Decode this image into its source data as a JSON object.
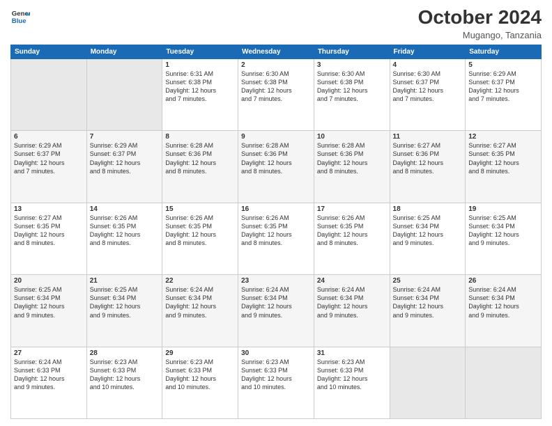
{
  "header": {
    "logo_line1": "General",
    "logo_line2": "Blue",
    "month": "October 2024",
    "location": "Mugango, Tanzania"
  },
  "weekdays": [
    "Sunday",
    "Monday",
    "Tuesday",
    "Wednesday",
    "Thursday",
    "Friday",
    "Saturday"
  ],
  "weeks": [
    [
      {
        "day": "",
        "info": ""
      },
      {
        "day": "",
        "info": ""
      },
      {
        "day": "1",
        "info": "Sunrise: 6:31 AM\nSunset: 6:38 PM\nDaylight: 12 hours\nand 7 minutes."
      },
      {
        "day": "2",
        "info": "Sunrise: 6:30 AM\nSunset: 6:38 PM\nDaylight: 12 hours\nand 7 minutes."
      },
      {
        "day": "3",
        "info": "Sunrise: 6:30 AM\nSunset: 6:38 PM\nDaylight: 12 hours\nand 7 minutes."
      },
      {
        "day": "4",
        "info": "Sunrise: 6:30 AM\nSunset: 6:37 PM\nDaylight: 12 hours\nand 7 minutes."
      },
      {
        "day": "5",
        "info": "Sunrise: 6:29 AM\nSunset: 6:37 PM\nDaylight: 12 hours\nand 7 minutes."
      }
    ],
    [
      {
        "day": "6",
        "info": "Sunrise: 6:29 AM\nSunset: 6:37 PM\nDaylight: 12 hours\nand 7 minutes."
      },
      {
        "day": "7",
        "info": "Sunrise: 6:29 AM\nSunset: 6:37 PM\nDaylight: 12 hours\nand 8 minutes."
      },
      {
        "day": "8",
        "info": "Sunrise: 6:28 AM\nSunset: 6:36 PM\nDaylight: 12 hours\nand 8 minutes."
      },
      {
        "day": "9",
        "info": "Sunrise: 6:28 AM\nSunset: 6:36 PM\nDaylight: 12 hours\nand 8 minutes."
      },
      {
        "day": "10",
        "info": "Sunrise: 6:28 AM\nSunset: 6:36 PM\nDaylight: 12 hours\nand 8 minutes."
      },
      {
        "day": "11",
        "info": "Sunrise: 6:27 AM\nSunset: 6:36 PM\nDaylight: 12 hours\nand 8 minutes."
      },
      {
        "day": "12",
        "info": "Sunrise: 6:27 AM\nSunset: 6:35 PM\nDaylight: 12 hours\nand 8 minutes."
      }
    ],
    [
      {
        "day": "13",
        "info": "Sunrise: 6:27 AM\nSunset: 6:35 PM\nDaylight: 12 hours\nand 8 minutes."
      },
      {
        "day": "14",
        "info": "Sunrise: 6:26 AM\nSunset: 6:35 PM\nDaylight: 12 hours\nand 8 minutes."
      },
      {
        "day": "15",
        "info": "Sunrise: 6:26 AM\nSunset: 6:35 PM\nDaylight: 12 hours\nand 8 minutes."
      },
      {
        "day": "16",
        "info": "Sunrise: 6:26 AM\nSunset: 6:35 PM\nDaylight: 12 hours\nand 8 minutes."
      },
      {
        "day": "17",
        "info": "Sunrise: 6:26 AM\nSunset: 6:35 PM\nDaylight: 12 hours\nand 8 minutes."
      },
      {
        "day": "18",
        "info": "Sunrise: 6:25 AM\nSunset: 6:34 PM\nDaylight: 12 hours\nand 9 minutes."
      },
      {
        "day": "19",
        "info": "Sunrise: 6:25 AM\nSunset: 6:34 PM\nDaylight: 12 hours\nand 9 minutes."
      }
    ],
    [
      {
        "day": "20",
        "info": "Sunrise: 6:25 AM\nSunset: 6:34 PM\nDaylight: 12 hours\nand 9 minutes."
      },
      {
        "day": "21",
        "info": "Sunrise: 6:25 AM\nSunset: 6:34 PM\nDaylight: 12 hours\nand 9 minutes."
      },
      {
        "day": "22",
        "info": "Sunrise: 6:24 AM\nSunset: 6:34 PM\nDaylight: 12 hours\nand 9 minutes."
      },
      {
        "day": "23",
        "info": "Sunrise: 6:24 AM\nSunset: 6:34 PM\nDaylight: 12 hours\nand 9 minutes."
      },
      {
        "day": "24",
        "info": "Sunrise: 6:24 AM\nSunset: 6:34 PM\nDaylight: 12 hours\nand 9 minutes."
      },
      {
        "day": "25",
        "info": "Sunrise: 6:24 AM\nSunset: 6:34 PM\nDaylight: 12 hours\nand 9 minutes."
      },
      {
        "day": "26",
        "info": "Sunrise: 6:24 AM\nSunset: 6:34 PM\nDaylight: 12 hours\nand 9 minutes."
      }
    ],
    [
      {
        "day": "27",
        "info": "Sunrise: 6:24 AM\nSunset: 6:33 PM\nDaylight: 12 hours\nand 9 minutes."
      },
      {
        "day": "28",
        "info": "Sunrise: 6:23 AM\nSunset: 6:33 PM\nDaylight: 12 hours\nand 10 minutes."
      },
      {
        "day": "29",
        "info": "Sunrise: 6:23 AM\nSunset: 6:33 PM\nDaylight: 12 hours\nand 10 minutes."
      },
      {
        "day": "30",
        "info": "Sunrise: 6:23 AM\nSunset: 6:33 PM\nDaylight: 12 hours\nand 10 minutes."
      },
      {
        "day": "31",
        "info": "Sunrise: 6:23 AM\nSunset: 6:33 PM\nDaylight: 12 hours\nand 10 minutes."
      },
      {
        "day": "",
        "info": ""
      },
      {
        "day": "",
        "info": ""
      }
    ]
  ]
}
